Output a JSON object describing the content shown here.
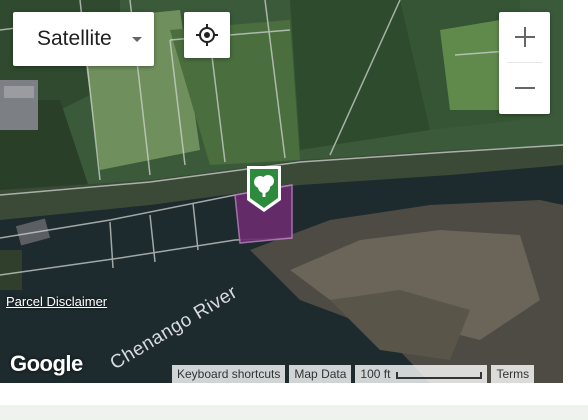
{
  "map": {
    "type_control": {
      "label": "Satellite",
      "caret_icon": "chevron-down-icon"
    },
    "locate_icon": "crosshair-target-icon",
    "zoom": {
      "in_icon": "plus-icon",
      "out_icon": "minus-icon"
    },
    "parcel_disclaimer": "Parcel Disclaimer",
    "river_label": "Chenango River",
    "logo_text": "Google",
    "marker_icon": "tree-pin-icon",
    "highlight_color": "#6b2d6f",
    "attribution": {
      "keyboard_shortcuts": "Keyboard shortcuts",
      "map_data": "Map Data",
      "scale_label": "100 ft",
      "terms": "Terms"
    }
  }
}
